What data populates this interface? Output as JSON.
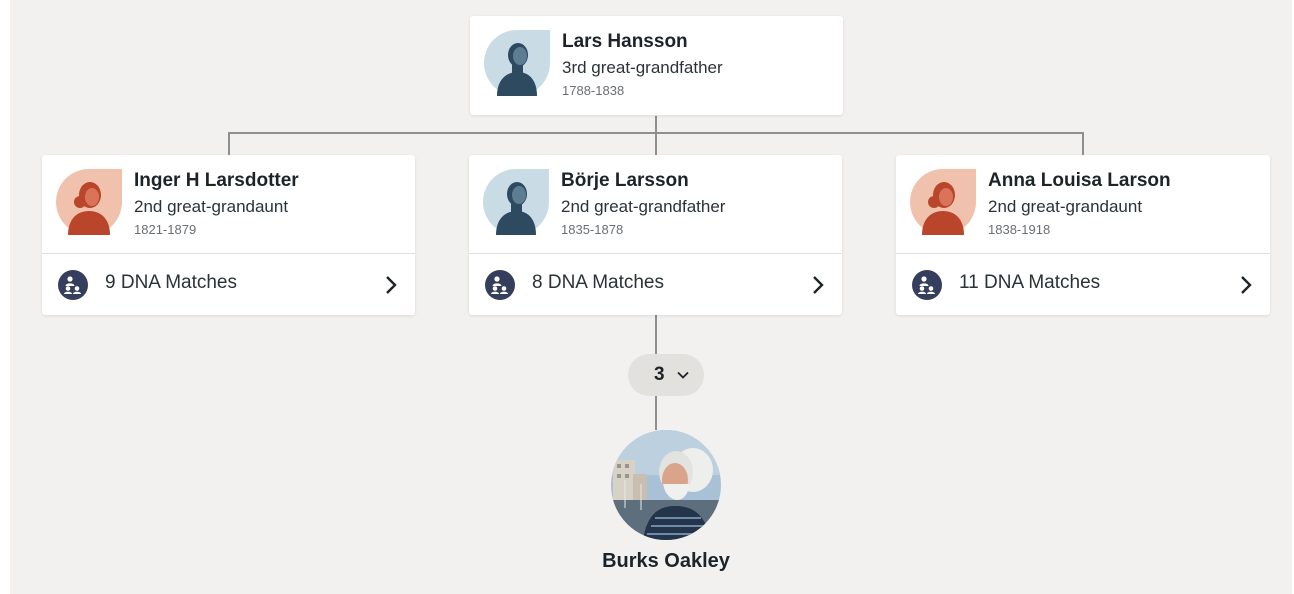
{
  "root": {
    "name": "Lars Hansson",
    "relationship": "3rd great-grandfather",
    "dates": "1788-1838",
    "avatar_icon": "male-avatar-icon"
  },
  "children": [
    {
      "name": "Inger H Larsdotter",
      "relationship": "2nd great-grandaunt",
      "dates": "1821-1879",
      "avatar_icon": "female-avatar-icon",
      "matches_label": "9 DNA Matches"
    },
    {
      "name": "Börje Larsson",
      "relationship": "2nd great-grandfather",
      "dates": "1835-1878",
      "avatar_icon": "male-avatar-icon",
      "matches_label": "8 DNA Matches"
    },
    {
      "name": "Anna Louisa Larson",
      "relationship": "2nd great-grandaunt",
      "dates": "1838-1918",
      "avatar_icon": "female-avatar-icon",
      "matches_label": "11 DNA Matches"
    }
  ],
  "generations_toggle": {
    "count": "3",
    "icon": "chevron-down-icon"
  },
  "self": {
    "name": "Burks Oakley",
    "photo_icon": "profile-photo"
  },
  "colors": {
    "background": "#f3f1ef",
    "connector": "#8f8f8f",
    "male_avatar_bg": "#c9dce6",
    "male_avatar_figure": "#2e4a60",
    "female_avatar_bg": "#f0c2ae",
    "female_avatar_figure": "#b9452a",
    "dna_icon_bg": "#353e5c"
  }
}
